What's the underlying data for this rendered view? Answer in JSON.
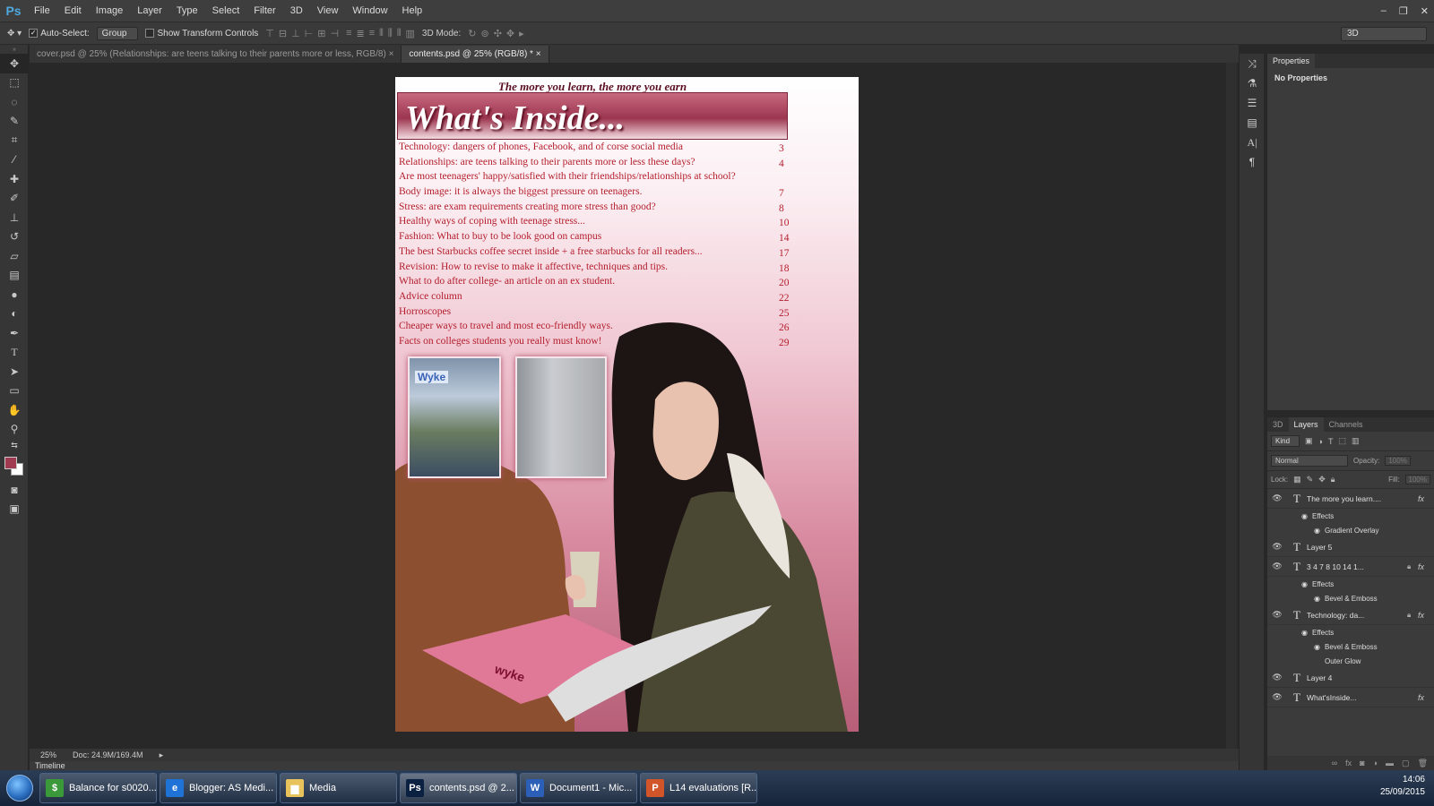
{
  "app": {
    "logo": "Ps",
    "window_controls": [
      "–",
      "❐",
      "✕"
    ]
  },
  "menu": [
    "File",
    "Edit",
    "Image",
    "Layer",
    "Type",
    "Select",
    "Filter",
    "3D",
    "View",
    "Window",
    "Help"
  ],
  "options_bar": {
    "auto_select_label": "Auto-Select:",
    "auto_select_checked": true,
    "auto_select_target": "Group",
    "show_transform_label": "Show Transform Controls",
    "show_transform_checked": false,
    "mode_3d_label": "3D Mode:",
    "workspace": "3D"
  },
  "tabs": [
    {
      "label": "cover.psd @ 25% (Relationships:  are teens talking to their parents more or less, RGB/8)",
      "close": "×",
      "active": false
    },
    {
      "label": "contents.psd @ 25% (RGB/8) *",
      "close": "×",
      "active": true
    }
  ],
  "status": {
    "zoom": "25%",
    "doc": "Doc: 24.9M/169.4M"
  },
  "timeline_label": "Timeline",
  "document": {
    "tagline": "The more you learn, the more you earn",
    "title": "What's Inside...",
    "contents": [
      {
        "text": "Technology: dangers of phones, Facebook, and of corse social media",
        "page": "3"
      },
      {
        "text": "Relationships: are teens talking to their parents more or less these days?",
        "page": "4"
      },
      {
        "text": " Are most teenagers' happy/satisfied with their friendships/relationships at school?",
        "page": ""
      },
      {
        "text": "Body image: it is always the biggest pressure on teenagers.",
        "page": "7"
      },
      {
        "text": "Stress: are exam requirements creating more stress than good?",
        "page": "8"
      },
      {
        "text": "Healthy ways of coping with teenage stress...",
        "page": "10"
      },
      {
        "text": "Fashion: What to buy to be look good on campus",
        "page": "14"
      },
      {
        "text": "The best Starbucks coffee secret inside + a free starbucks for all readers...",
        "page": "17"
      },
      {
        "text": "Revision: How to revise to make it affective, techniques and tips.",
        "page": "18"
      },
      {
        "text": "What to do after college- an article on an ex student.",
        "page": "20"
      },
      {
        "text": "Advice column",
        "page": "22"
      },
      {
        "text": "Horroscopes",
        "page": "25"
      },
      {
        "text": "Cheaper ways to travel and most eco-friendly ways.",
        "page": "26"
      },
      {
        "text": "Facts on colleges students you really must know!",
        "page": "29"
      }
    ],
    "photo1_sign": "Wyke",
    "magazine_print": "wyke"
  },
  "properties": {
    "tab": "Properties",
    "content": "No Properties"
  },
  "layers_panel": {
    "tabs": [
      "3D",
      "Layers",
      "Channels"
    ],
    "active_tab": "Layers",
    "filter_kind": "Kind",
    "blend_mode": "Normal",
    "opacity_label": "Opacity:",
    "opacity_value": "100%",
    "lock_label": "Lock:",
    "fill_label": "Fill:",
    "fill_value": "100%",
    "layers": [
      {
        "name": "The more you learn....",
        "fx": "fx",
        "lock": false,
        "effects": [
          "Gradient Overlay"
        ]
      },
      {
        "name": "Layer 5",
        "fx": "",
        "lock": false,
        "effects": []
      },
      {
        "name": "3 4  7 8 10 14 1...",
        "fx": "fx",
        "lock": true,
        "effects": [
          "Bevel & Emboss"
        ]
      },
      {
        "name": "Technology: da...",
        "fx": "fx",
        "lock": true,
        "effects": [
          "Bevel & Emboss",
          "Outer Glow"
        ]
      },
      {
        "name": "Layer 4",
        "fx": "",
        "lock": false,
        "effects": []
      },
      {
        "name": "What'sInside...",
        "fx": "fx",
        "lock": false,
        "effects": []
      }
    ],
    "effects_label": "Effects"
  },
  "taskbar": {
    "items": [
      {
        "label": "Balance for s0020...",
        "icon": "$",
        "icon_bg": "#3a9a3a",
        "active": false
      },
      {
        "label": "Blogger: AS Medi...",
        "icon": "e",
        "icon_bg": "#1f73d6",
        "active": false
      },
      {
        "label": "Media",
        "icon": "▆",
        "icon_bg": "#e8c35c",
        "active": false
      },
      {
        "label": "contents.psd @ 2...",
        "icon": "Ps",
        "icon_bg": "#0b2142",
        "active": true
      },
      {
        "label": "Document1 - Mic...",
        "icon": "W",
        "icon_bg": "#2b5fb8",
        "active": false
      },
      {
        "label": "L14 evaluations [R...",
        "icon": "P",
        "icon_bg": "#d2552a",
        "active": false
      }
    ],
    "time": "14:06",
    "date": "25/09/2015"
  }
}
